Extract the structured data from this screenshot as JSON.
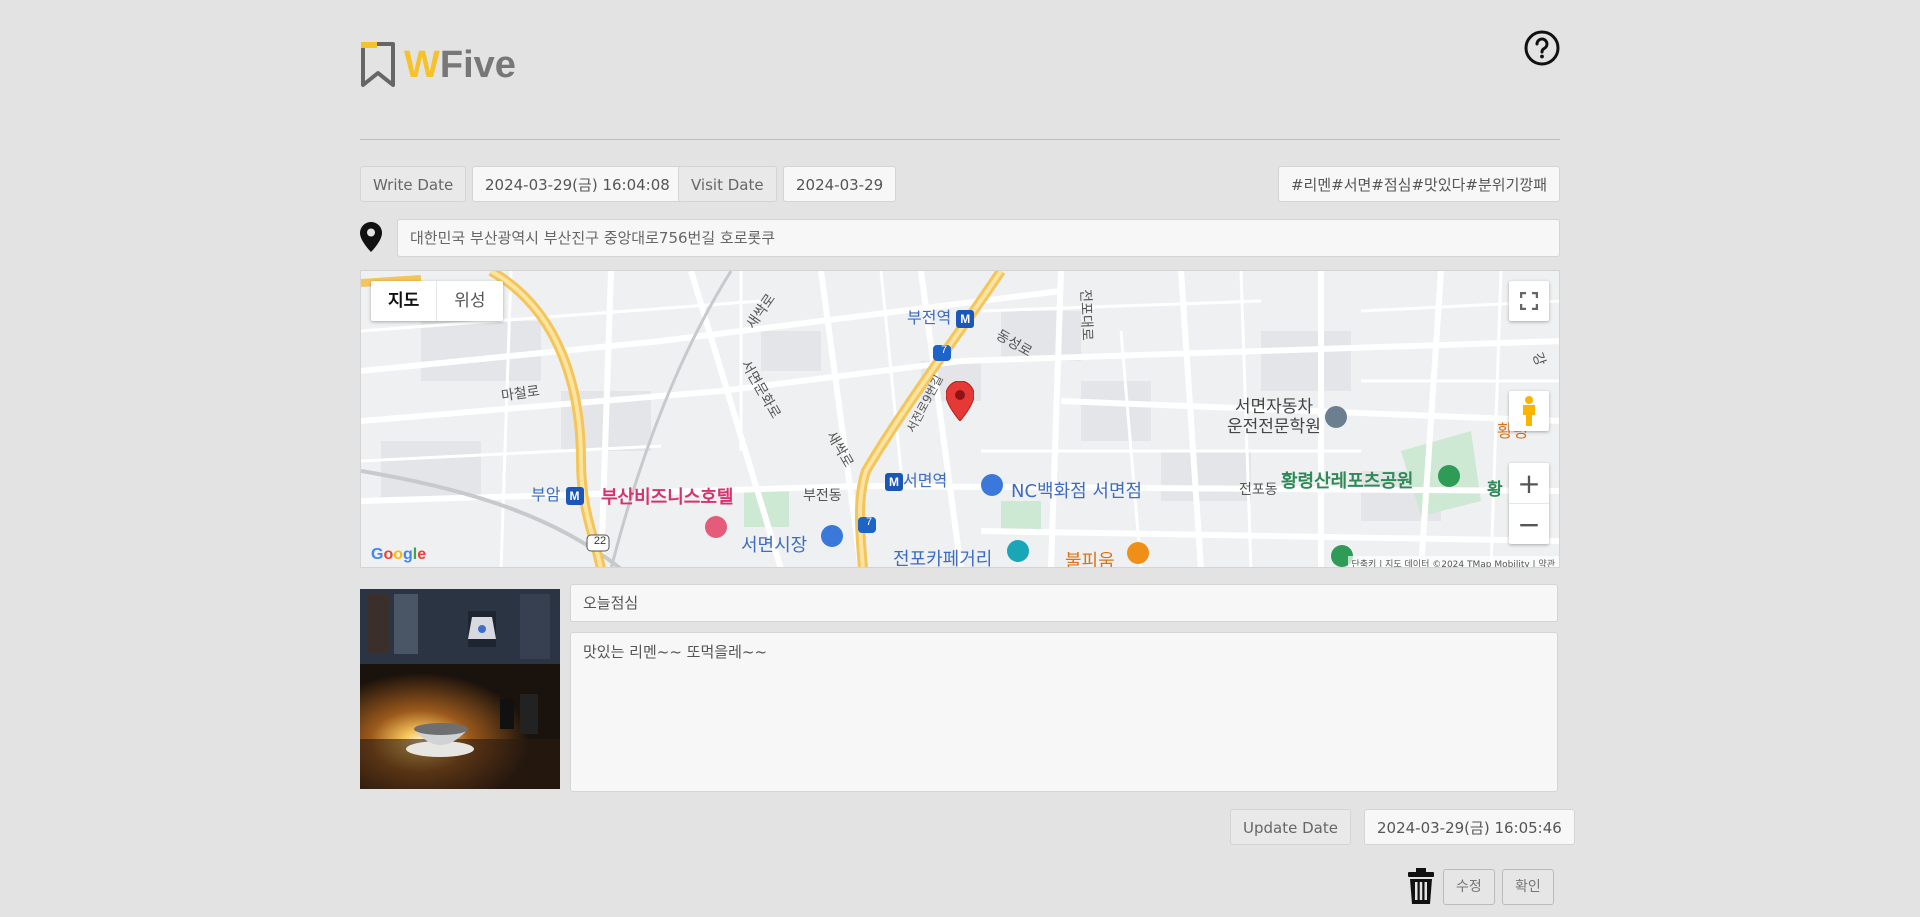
{
  "header": {
    "logo_w": "W",
    "logo_rest": "Five"
  },
  "dates": {
    "write_label": "Write Date",
    "write_value": "2024-03-29(금) 16:04:08",
    "visit_label": "Visit Date",
    "visit_value": "2024-03-29",
    "tags": "#리멘#서면#점심#맛있다#분위기깡패"
  },
  "address": "대한민국 부산광역시 부산진구 중앙대로756번길 호로롯쿠",
  "map": {
    "type_map": "지도",
    "type_satellite": "위성",
    "labels": {
      "bujeon_station": "부전역",
      "dongseong_ro": "동성로",
      "jeonpo_daero": "전포대로",
      "saessak_ro_1": "새싹로",
      "seomyeon_munhwa_ro": "서면문화로",
      "macheol_ro": "마철로",
      "saessak_ro_2": "새싹로",
      "seojeon_ro": "서전로9번길",
      "driving_school": "서면자동차\n운전전문학원",
      "buam": "부암",
      "busan_business_hotel": "부산비즈니스호텔",
      "bujeon_dong": "부전동",
      "seomyeon_station": "서면역",
      "nc_department": "NC백화점 서면점",
      "jeonpo_dong": "전포동",
      "hwangryeong_park": "황령산레포츠공원",
      "seomyeon_market": "서면시장",
      "jeonpo_cafe": "전포카페거리",
      "bulpium": "불피움",
      "hwang_partial": "황령",
      "hwang_partial2": "황",
      "gang_partial": "강",
      "route7": "7",
      "route22": "22",
      "metro": "M"
    },
    "google": "Google",
    "attribution": "단축키 | 지도 데이터 ©2024 TMap Mobility | 약관"
  },
  "post": {
    "title": "오늘점심",
    "body": "맛있는 리멘~~ 또먹을레~~"
  },
  "update": {
    "label": "Update Date",
    "value": "2024-03-29(금) 16:05:46"
  },
  "buttons": {
    "edit": "수정",
    "confirm": "확인"
  },
  "colors": {
    "brand_yellow": "#f6c22a",
    "brand_gray": "#777777",
    "background": "#e3e3e3",
    "map_road": "#f7c95c",
    "marker_red": "#e53935"
  },
  "icons": [
    "bookmark-logo-icon",
    "help-circle-icon",
    "location-pin-icon",
    "fullscreen-icon",
    "pegman-icon",
    "map-marker-icon",
    "trash-icon"
  ]
}
